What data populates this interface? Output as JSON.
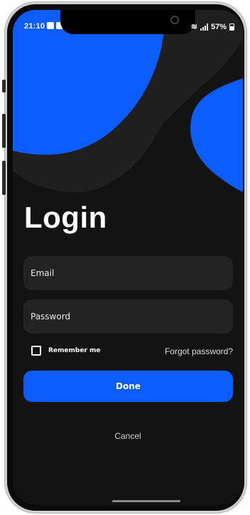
{
  "status_bar": {
    "time": "21:10",
    "battery": "57%"
  },
  "login": {
    "title": "Login",
    "email_placeholder": "Email",
    "password_placeholder": "Password",
    "remember_label": "Remember me",
    "forgot_label": "Forgot password?",
    "done_label": "Done",
    "cancel_label": "Cancel"
  },
  "colors": {
    "accent": "#0d5cff",
    "background": "#131313",
    "field": "#232323"
  }
}
